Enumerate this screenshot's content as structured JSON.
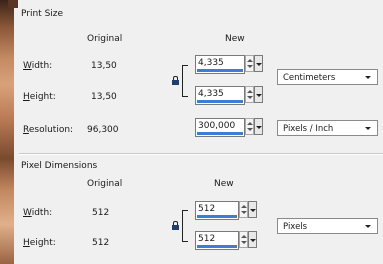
{
  "print_size": {
    "title": "Print Size",
    "col_original": "Original",
    "col_new": "New",
    "width": {
      "label_pre": "W",
      "label_post": "idth:",
      "original": "13,50",
      "new": "4,335"
    },
    "height": {
      "label_pre": "H",
      "label_post": "eight:",
      "original": "13,50",
      "new": "4,335"
    },
    "resolution": {
      "label_pre": "R",
      "label_post": "esolution:",
      "original": "96,300",
      "new": "300,000"
    },
    "unit_select": "Centimeters",
    "resolution_unit_select": "Pixels / Inch"
  },
  "pixel_dimensions": {
    "title": "Pixel Dimensions",
    "col_original": "Original",
    "col_new": "New",
    "width": {
      "label_pre": "W",
      "label_post": "idth:",
      "original": "512",
      "new": "512"
    },
    "height": {
      "label_pre": "H",
      "label_post": "eight:",
      "original": "512",
      "new": "512"
    },
    "unit_select": "Pixels"
  },
  "icons": {
    "lock": "lock-icon",
    "spinner": "spinner-icon",
    "dropdown": "dropdown-arrow-icon"
  },
  "colors": {
    "background": "#f0f0f0",
    "field_accent": "#3a7fd6",
    "lock": "#1f3f73"
  }
}
